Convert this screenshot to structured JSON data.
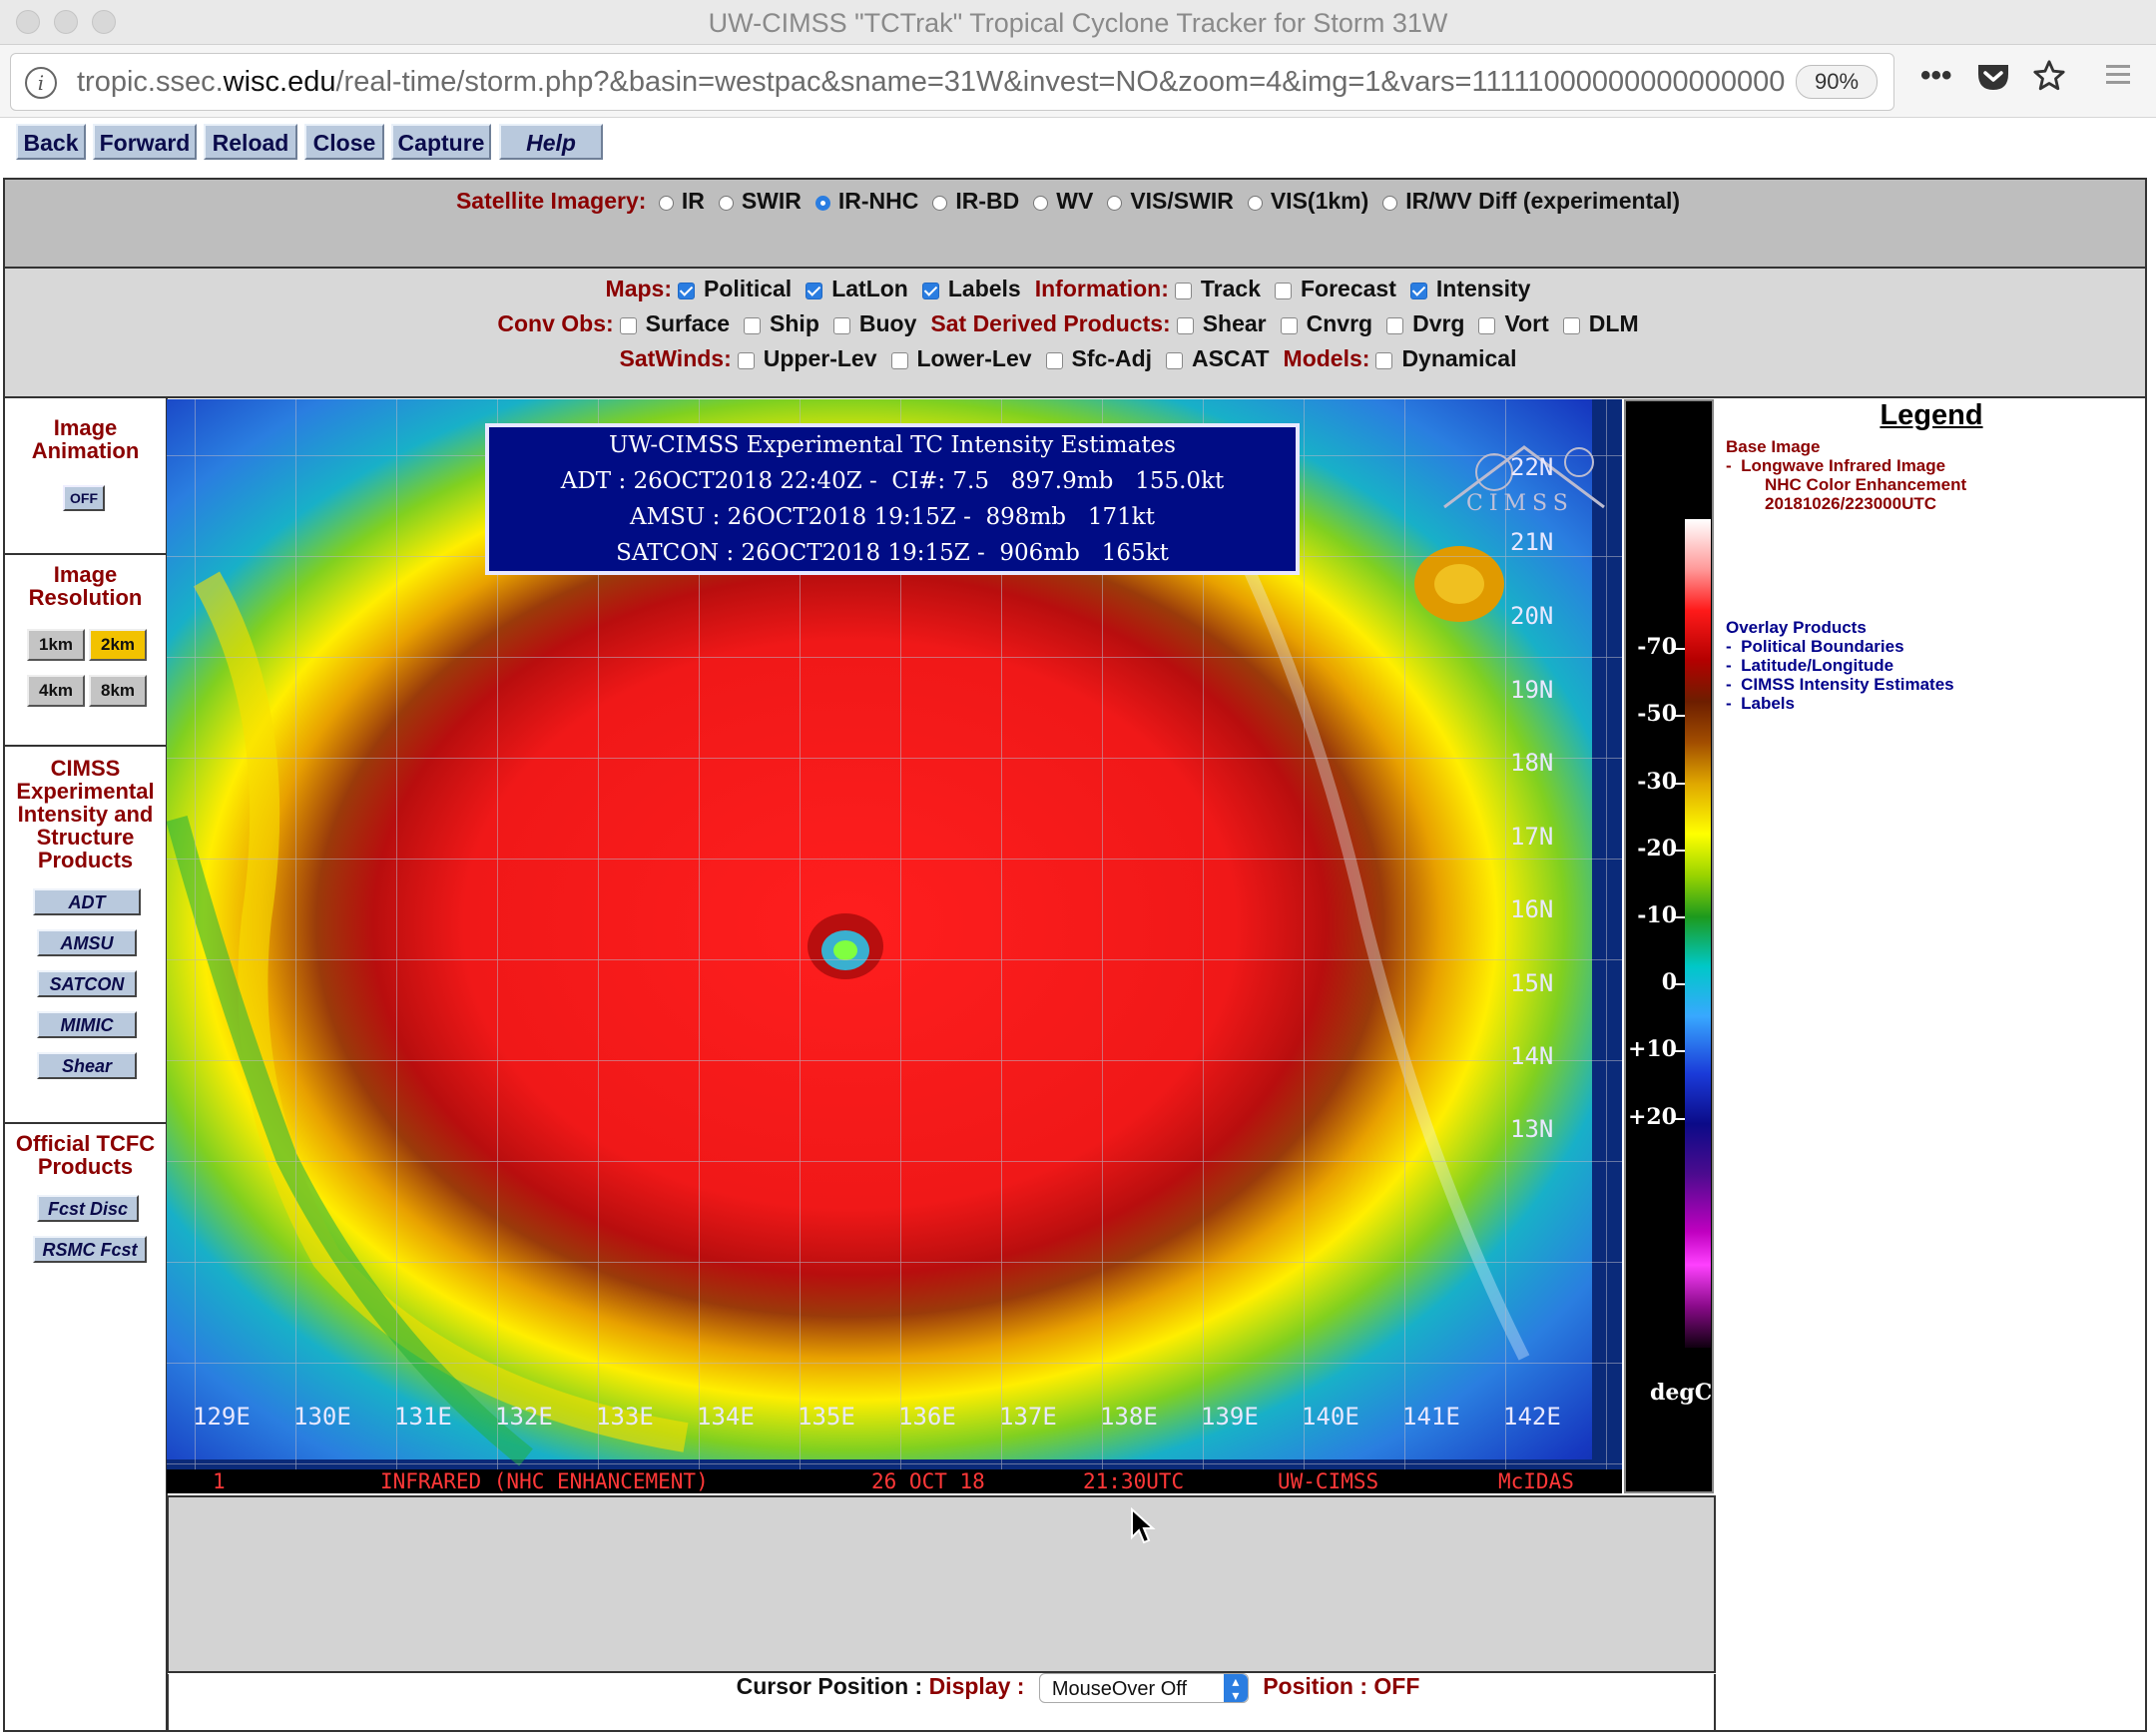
{
  "window": {
    "title": "UW-CIMSS \"TCTrak\" Tropical Cyclone Tracker for Storm 31W"
  },
  "browser": {
    "url_host_prefix": "tropic.ssec.",
    "url_host_domain": "wisc.edu",
    "url_path": "/real-time/storm.php?&basin=westpac&sname=31W&invest=NO&zoom=4&img=1&vars=11111000000000000000",
    "zoom": "90%"
  },
  "nav_buttons": {
    "back": "Back",
    "forward": "Forward",
    "reload": "Reload",
    "close": "Close",
    "capture": "Capture",
    "help": "Help"
  },
  "satellite_imagery": {
    "label": "Satellite Imagery:",
    "options": [
      {
        "label": "IR",
        "selected": false
      },
      {
        "label": "SWIR",
        "selected": false
      },
      {
        "label": "IR-NHC",
        "selected": true
      },
      {
        "label": "IR-BD",
        "selected": false
      },
      {
        "label": "WV",
        "selected": false
      },
      {
        "label": "VIS/SWIR",
        "selected": false
      },
      {
        "label": "VIS(1km)",
        "selected": false
      },
      {
        "label": "IR/WV Diff (experimental)",
        "selected": false
      }
    ]
  },
  "options": {
    "maps_label": "Maps:",
    "maps": [
      {
        "label": "Political",
        "checked": true
      },
      {
        "label": "LatLon",
        "checked": true
      },
      {
        "label": "Labels",
        "checked": true
      }
    ],
    "information_label": "Information:",
    "information": [
      {
        "label": "Track",
        "checked": false
      },
      {
        "label": "Forecast",
        "checked": false
      },
      {
        "label": "Intensity",
        "checked": true
      }
    ],
    "conv_obs_label": "Conv Obs:",
    "conv_obs": [
      {
        "label": "Surface",
        "checked": false
      },
      {
        "label": "Ship",
        "checked": false
      },
      {
        "label": "Buoy",
        "checked": false
      }
    ],
    "sat_derived_label": "Sat Derived Products:",
    "sat_derived": [
      {
        "label": "Shear",
        "checked": false
      },
      {
        "label": "Cnvrg",
        "checked": false
      },
      {
        "label": "Dvrg",
        "checked": false
      },
      {
        "label": "Vort",
        "checked": false
      },
      {
        "label": "DLM",
        "checked": false
      }
    ],
    "satwinds_label": "SatWinds:",
    "satwinds": [
      {
        "label": "Upper-Lev",
        "checked": false
      },
      {
        "label": "Lower-Lev",
        "checked": false
      },
      {
        "label": "Sfc-Adj",
        "checked": false
      },
      {
        "label": "ASCAT",
        "checked": false
      }
    ],
    "models_label": "Models:",
    "models": [
      {
        "label": "Dynamical",
        "checked": false
      }
    ]
  },
  "sidebar": {
    "animation_title": "Image Animation",
    "animation_button": "OFF",
    "resolution_title": "Image Resolution",
    "resolutions": [
      {
        "label": "1km",
        "selected": false
      },
      {
        "label": "2km",
        "selected": true
      },
      {
        "label": "4km",
        "selected": false
      },
      {
        "label": "8km",
        "selected": false
      }
    ],
    "cimss_title": "CIMSS Experimental Intensity and Structure Products",
    "cimss_buttons": [
      "ADT",
      "AMSU",
      "SATCON",
      "MIMIC",
      "Shear"
    ],
    "tcfc_title": "Official TCFC Products",
    "tcfc_buttons": [
      "Fcst Disc",
      "RSMC Fcst"
    ]
  },
  "satellite_image": {
    "intensity_title": "UW-CIMSS Experimental TC Intensity Estimates",
    "intensity_lines": [
      "ADT : 26OCT2018 22:40Z -  CI#: 7.5   897.9mb   155.0kt",
      "AMSU : 26OCT2018 19:15Z -  898mb   171kt",
      "SATCON : 26OCT2018 19:15Z -  906mb   165kt"
    ],
    "logo_text": "CIMSS",
    "lat_labels": [
      "22N",
      "21N",
      "20N",
      "19N",
      "18N",
      "17N",
      "16N",
      "15N",
      "14N",
      "13N"
    ],
    "lon_labels": [
      "129E",
      "130E",
      "131E",
      "132E",
      "133E",
      "134E",
      "135E",
      "136E",
      "137E",
      "138E",
      "139E",
      "140E",
      "141E",
      "142E"
    ],
    "strip": {
      "frame": "1",
      "product": "INFRARED (NHC ENHANCEMENT)",
      "date": "26 OCT 18",
      "time": "21:30UTC",
      "source": "UW-CIMSS",
      "software": "McIDAS"
    }
  },
  "colorbar": {
    "ticks": [
      "-70",
      "-50",
      "-30",
      "-20",
      "-10",
      "0",
      "+10",
      "+20"
    ],
    "unit": "degC"
  },
  "legend": {
    "title": "Legend",
    "base_image_label": "Base Image",
    "base_image_lines": [
      "Longwave Infrared Image",
      "NHC Color Enhancement",
      "20181026/223000UTC"
    ],
    "overlay_label": "Overlay Products",
    "overlay_items": [
      "Political Boundaries",
      "Latitude/Longitude",
      "CIMSS Intensity Estimates",
      "Labels"
    ]
  },
  "cursor_position": {
    "label": "Cursor Position :",
    "display_label": "Display :",
    "display_value": "MouseOver Off",
    "position_label": "Position : OFF"
  },
  "colors": {
    "accent_blue": "#2a7de1",
    "label_red": "#8b0000",
    "button_bg": "#b9c9dd"
  }
}
